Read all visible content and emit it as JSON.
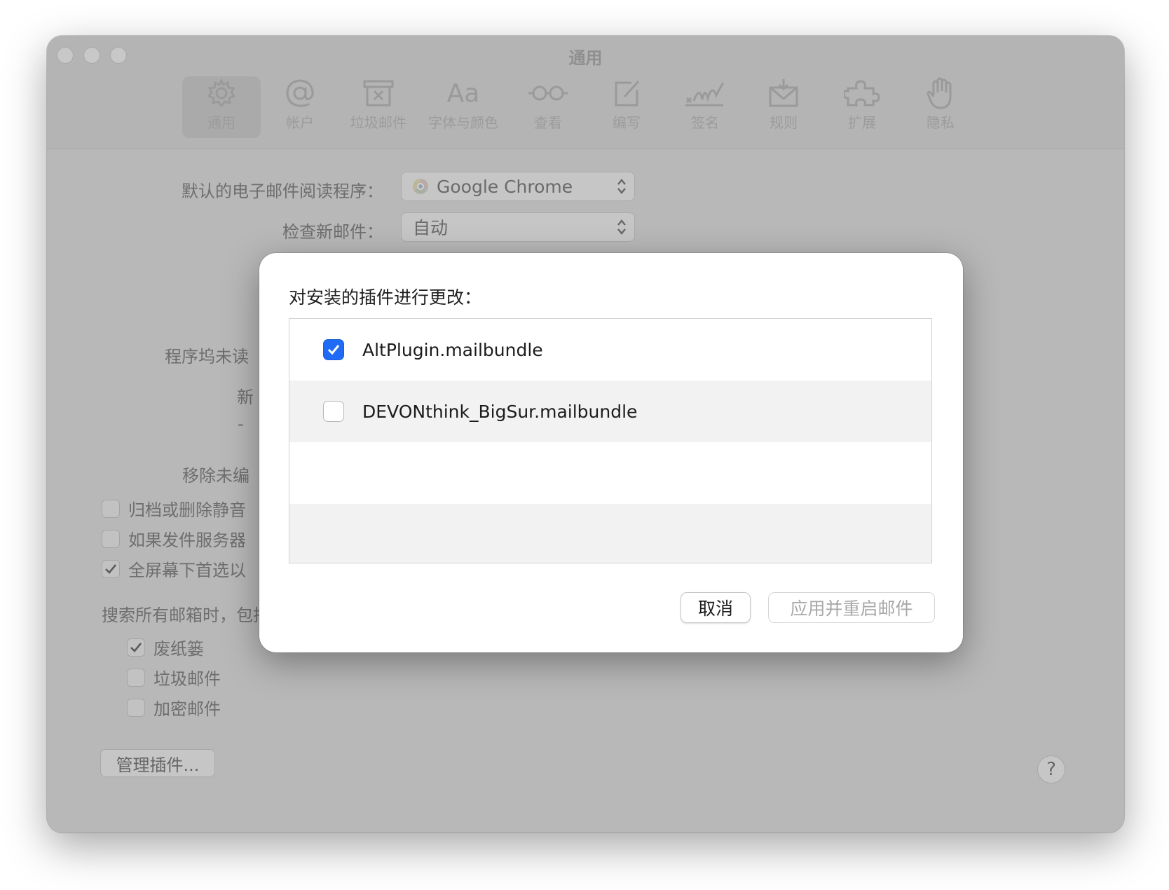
{
  "window": {
    "title": "通用"
  },
  "toolbar": {
    "items": [
      {
        "label": "通用",
        "icon": "gear-icon",
        "active": true
      },
      {
        "label": "帐户",
        "icon": "at-icon",
        "active": false
      },
      {
        "label": "垃圾邮件",
        "icon": "junk-tray-icon",
        "active": false
      },
      {
        "label": "字体与颜色",
        "icon": "font-icon",
        "active": false,
        "glyph": "Aa"
      },
      {
        "label": "查看",
        "icon": "glasses-icon",
        "active": false
      },
      {
        "label": "编写",
        "icon": "compose-icon",
        "active": false
      },
      {
        "label": "签名",
        "icon": "signature-icon",
        "active": false
      },
      {
        "label": "规则",
        "icon": "rules-envelope-icon",
        "active": false
      },
      {
        "label": "扩展",
        "icon": "puzzle-icon",
        "active": false
      },
      {
        "label": "隐私",
        "icon": "hand-icon",
        "active": false
      }
    ]
  },
  "general": {
    "default_reader_label": "默认的电子邮件阅读程序：",
    "default_reader_value": "Google Chrome",
    "check_mail_label": "检查新邮件：",
    "check_mail_value": "自动",
    "dock_label_partial": "程序坞未读",
    "new_partial": "新",
    "dash_partial": "-",
    "remove_partial": "移除未编",
    "archive_partial": "归档或删除静音",
    "server_partial": "如果发件服务器",
    "fullscreen_partial": "全屏幕下首选以",
    "search_heading": "搜索所有邮箱时，包括的结果来自：",
    "search_options": [
      {
        "label": "废纸篓",
        "checked": true
      },
      {
        "label": "垃圾邮件",
        "checked": false
      },
      {
        "label": "加密邮件",
        "checked": false
      }
    ],
    "manage_plugins_button": "管理插件...",
    "help_button": "?"
  },
  "dialog": {
    "title": "对安装的插件进行更改：",
    "plugins": [
      {
        "name": "AltPlugin.mailbundle",
        "checked": true
      },
      {
        "name": "DEVONthink_BigSur.mailbundle",
        "checked": false
      }
    ],
    "cancel_button": "取消",
    "apply_button": "应用并重启邮件",
    "accent_color": "#1f6bf5"
  }
}
